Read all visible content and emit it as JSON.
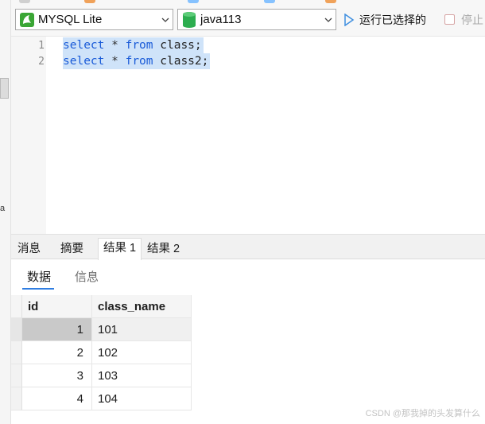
{
  "toolbar": {
    "connection": {
      "label": "MYSQL Lite",
      "icon": "mysql-dolphin-icon",
      "icon_color": "#3aa635"
    },
    "database": {
      "label": "java113",
      "icon": "database-cylinder-icon",
      "icon_color": "#27a34a"
    },
    "run_selected": {
      "label": "运行已选择的",
      "icon": "play-icon"
    },
    "stop": {
      "label": "停止"
    }
  },
  "editor": {
    "lines": [
      {
        "number": "1",
        "tokens": [
          "select",
          "*",
          "from",
          "class;"
        ]
      },
      {
        "number": "2",
        "tokens": [
          "select",
          "*",
          "from",
          "class2;"
        ]
      }
    ],
    "selection_color": "#cfe3f9",
    "keyword_color": "#1a5bd8"
  },
  "results": {
    "tabs": [
      {
        "label": "消息"
      },
      {
        "label": "摘要"
      },
      {
        "label": "结果 1",
        "active": true
      },
      {
        "label": "结果 2"
      }
    ],
    "subtabs": [
      {
        "label": "数据",
        "active": true
      },
      {
        "label": "信息"
      }
    ],
    "grid": {
      "columns": [
        "id",
        "class_name"
      ],
      "rows": [
        [
          "1",
          "101"
        ],
        [
          "2",
          "102"
        ],
        [
          "3",
          "103"
        ],
        [
          "4",
          "104"
        ]
      ]
    }
  },
  "watermark": "CSDN @那我掉的头发算什么",
  "left_strip_glyph": "a"
}
